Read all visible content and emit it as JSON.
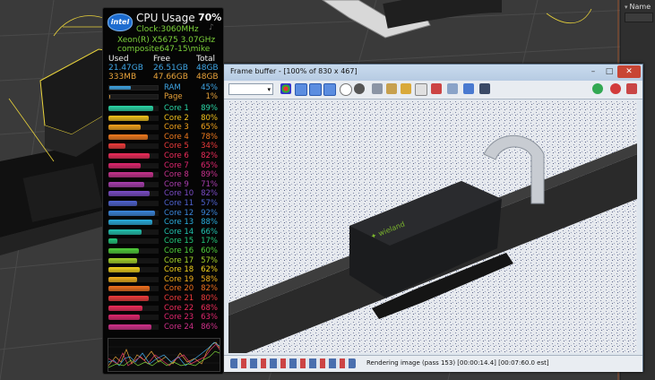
{
  "side_panel": {
    "name_label": "Name"
  },
  "frame_buffer": {
    "title": "Frame buffer - [100% of 830 x 467]",
    "status": "Rendering image (pass 153) [00:00:14.4] [00:07:60.0 est]",
    "colors": {
      "title_bg": "#c3d6ea",
      "close_bg": "#c84535"
    }
  },
  "gadget": {
    "logo": "intel",
    "title": "CPU Usage",
    "total_pct": "70%",
    "clock": "Clock:3060MHz",
    "note_icon": "music-note-icon",
    "cpu_name": "Xeon(R) X5675 3.07GHz",
    "host": "composite647-15\\mike",
    "memory": {
      "headers": [
        "Used",
        "Free",
        "Total"
      ],
      "ram_row": [
        "21.47GB",
        "26.51GB",
        "48GB"
      ],
      "page_row": [
        "333MB",
        "47.66GB",
        "48GB"
      ]
    },
    "mem_bars": [
      {
        "label": "RAM",
        "value": "45%",
        "fraction": 0.45,
        "color": "#3fa6e6"
      },
      {
        "label": "Page",
        "value": "1%",
        "fraction": 0.01,
        "color": "#e8a23a"
      }
    ],
    "cores": [
      {
        "label": "Core 1",
        "value": "89%",
        "fraction": 0.89,
        "color": "#2bd6a6"
      },
      {
        "label": "Core 2",
        "value": "80%",
        "fraction": 0.8,
        "color": "#f2c21c"
      },
      {
        "label": "Core 3",
        "value": "65%",
        "fraction": 0.65,
        "color": "#f2a21c"
      },
      {
        "label": "Core 4",
        "value": "78%",
        "fraction": 0.78,
        "color": "#f07a1e"
      },
      {
        "label": "Core 5",
        "value": "34%",
        "fraction": 0.34,
        "color": "#ee3b3b"
      },
      {
        "label": "Core 6",
        "value": "82%",
        "fraction": 0.82,
        "color": "#ee2c5a"
      },
      {
        "label": "Core 7",
        "value": "65%",
        "fraction": 0.65,
        "color": "#e0266e"
      },
      {
        "label": "Core 8",
        "value": "89%",
        "fraction": 0.89,
        "color": "#c7328e"
      },
      {
        "label": "Core 9",
        "value": "71%",
        "fraction": 0.71,
        "color": "#a83eae"
      },
      {
        "label": "Core 10",
        "value": "82%",
        "fraction": 0.82,
        "color": "#7a4cc6"
      },
      {
        "label": "Core 11",
        "value": "57%",
        "fraction": 0.57,
        "color": "#4f63d0"
      },
      {
        "label": "Core 12",
        "value": "92%",
        "fraction": 0.92,
        "color": "#3a86dc"
      },
      {
        "label": "Core 13",
        "value": "88%",
        "fraction": 0.88,
        "color": "#2aaede"
      },
      {
        "label": "Core 14",
        "value": "66%",
        "fraction": 0.66,
        "color": "#22c3b0"
      },
      {
        "label": "Core 15",
        "value": "17%",
        "fraction": 0.17,
        "color": "#22c97c"
      },
      {
        "label": "Core 16",
        "value": "60%",
        "fraction": 0.6,
        "color": "#50d03a"
      },
      {
        "label": "Core 17",
        "value": "57%",
        "fraction": 0.57,
        "color": "#a6d62a"
      },
      {
        "label": "Core 18",
        "value": "62%",
        "fraction": 0.62,
        "color": "#f2d21c"
      },
      {
        "label": "Core 19",
        "value": "58%",
        "fraction": 0.58,
        "color": "#f2b21c"
      },
      {
        "label": "Core 20",
        "value": "82%",
        "fraction": 0.82,
        "color": "#f0701e"
      },
      {
        "label": "Core 21",
        "value": "80%",
        "fraction": 0.8,
        "color": "#ee3b3b"
      },
      {
        "label": "Core 22",
        "value": "68%",
        "fraction": 0.68,
        "color": "#ee2c5a"
      },
      {
        "label": "Core 23",
        "value": "63%",
        "fraction": 0.63,
        "color": "#e0266e"
      },
      {
        "label": "Core 24",
        "value": "86%",
        "fraction": 0.86,
        "color": "#d0308a"
      }
    ]
  }
}
